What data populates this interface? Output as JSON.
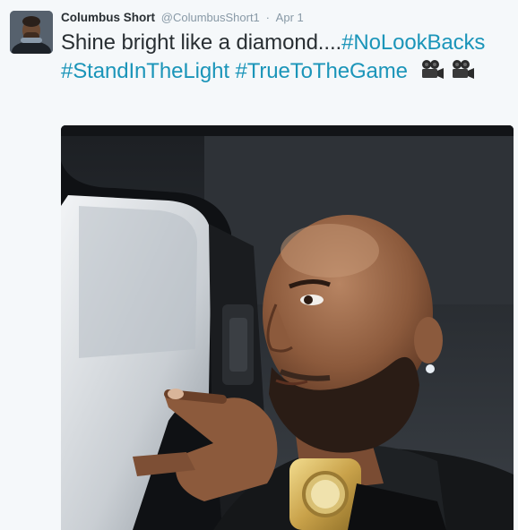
{
  "tweet": {
    "author_name": "Columbus Short",
    "author_handle": "@ColumbusShort1",
    "separator": "·",
    "timestamp": "Apr 1",
    "text_plain": "Shine bright like a diamond....",
    "hashtags": [
      "#NoLookBacks",
      "#StandInTheLight",
      "#TrueToTheGame"
    ],
    "emoji": [
      "movie-camera",
      "movie-camera"
    ]
  },
  "colors": {
    "hashtag": "#1b95b9",
    "text": "#292f33",
    "meta": "#8899a6",
    "background": "#f5f8fa"
  }
}
